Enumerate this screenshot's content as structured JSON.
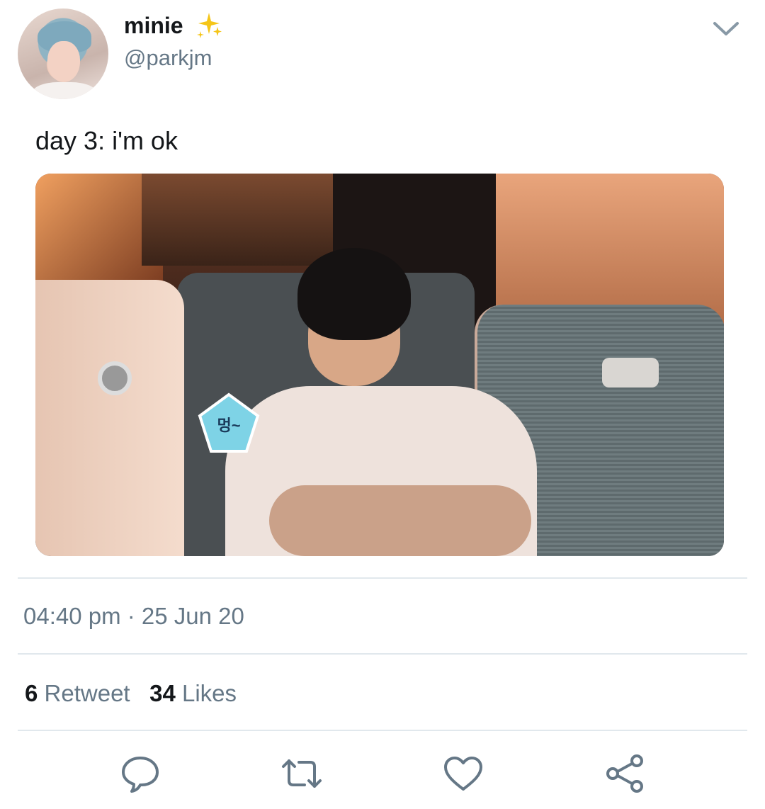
{
  "user": {
    "name": "minie",
    "handle": "@parkjm"
  },
  "tweet": {
    "text": "day 3: i'm ok",
    "media": {
      "sticker_text": "멍~"
    },
    "timestamp": "04:40 pm · 25 Jun 20"
  },
  "stats": {
    "retweet_count": "6",
    "retweet_label": "Retweet",
    "likes_count": "34",
    "likes_label": "Likes"
  },
  "actions": [
    "reply-icon",
    "retweet-icon",
    "like-icon",
    "share-icon"
  ],
  "colors": {
    "secondary_text": "#657786",
    "divider": "#e1e8ed",
    "icon": "#657786",
    "sparkle": "#f5c518"
  }
}
